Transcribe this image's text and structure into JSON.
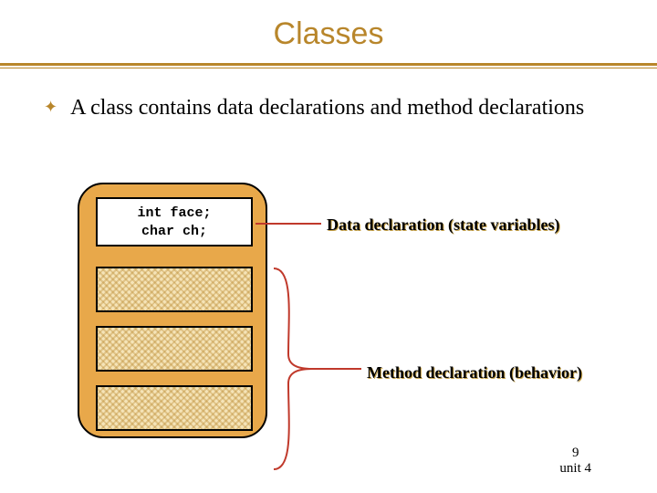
{
  "title": "Classes",
  "bullet": "A class contains data declarations and method declarations",
  "code": {
    "line1": "int face;",
    "line2": "char ch;"
  },
  "labels": {
    "data": "Data declaration (state variables)",
    "method": "Method declaration (behavior)"
  },
  "footer": {
    "page": "9",
    "unit": "unit 4"
  }
}
